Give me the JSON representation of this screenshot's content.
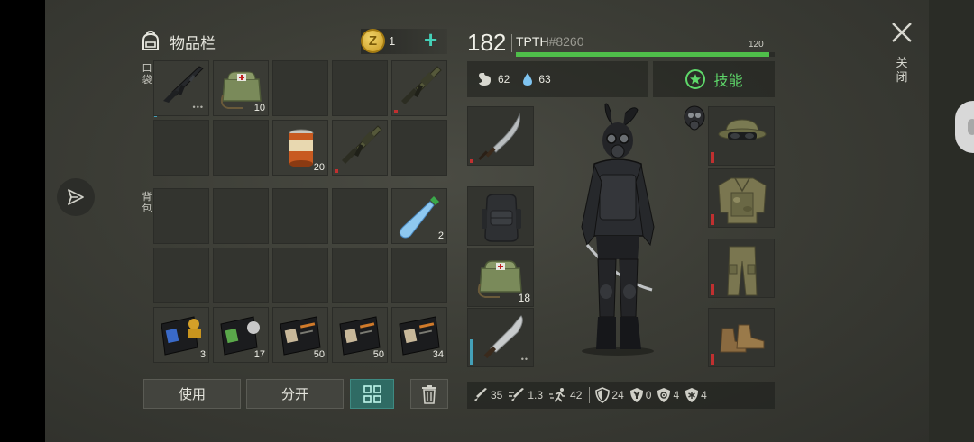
{
  "inventory": {
    "title": "物品栏",
    "coins": "1",
    "pocket_label": "口袋",
    "backpack_label": "背包",
    "pocket_slots": [
      {
        "item": "assault-rifle",
        "qty": "",
        "dots": "•••"
      },
      {
        "item": "medkit-bag",
        "qty": "10",
        "dots": ""
      },
      {
        "item": "",
        "qty": "",
        "dots": ""
      },
      {
        "item": "",
        "qty": "",
        "dots": ""
      },
      {
        "item": "grenade-launcher",
        "qty": "",
        "dots": ""
      },
      {
        "item": "",
        "qty": "",
        "dots": ""
      },
      {
        "item": "",
        "qty": "",
        "dots": ""
      },
      {
        "item": "canned-food",
        "qty": "20",
        "dots": ""
      },
      {
        "item": "grenade-launcher",
        "qty": "",
        "dots": ""
      },
      {
        "item": "",
        "qty": "",
        "dots": ""
      }
    ],
    "backpack_slots": [
      {
        "item": "",
        "qty": ""
      },
      {
        "item": "",
        "qty": ""
      },
      {
        "item": "",
        "qty": ""
      },
      {
        "item": "",
        "qty": ""
      },
      {
        "item": "water-bottle",
        "qty": "2"
      },
      {
        "item": "",
        "qty": ""
      },
      {
        "item": "",
        "qty": ""
      },
      {
        "item": "",
        "qty": ""
      },
      {
        "item": "",
        "qty": ""
      },
      {
        "item": "",
        "qty": ""
      },
      {
        "item": "id-card-blue",
        "qty": "3"
      },
      {
        "item": "id-card-green",
        "qty": "17"
      },
      {
        "item": "id-card-orange",
        "qty": "50"
      },
      {
        "item": "id-card-orange",
        "qty": "50"
      },
      {
        "item": "id-card-orange",
        "qty": "34"
      }
    ],
    "buttons": {
      "use": "使用",
      "split": "分开"
    }
  },
  "character": {
    "level": "182",
    "name": "TPTH",
    "tag": "#8260",
    "xp_max": "120",
    "xp_fraction": 0.98,
    "hunger": "62",
    "thirst": "63",
    "skills_label": "技能",
    "medkit_qty": "18"
  },
  "stats": {
    "attack": "35",
    "attack_speed": "1.3",
    "speed": "42",
    "armor": "24",
    "radiation": "0",
    "toxic": "4",
    "cold": "4"
  },
  "close_label": "关闭",
  "colors": {
    "accent_teal": "#44d0b8",
    "xp_green": "#4fbe4a",
    "skill_green": "#5ed86a",
    "durability_red": "#c03030"
  }
}
